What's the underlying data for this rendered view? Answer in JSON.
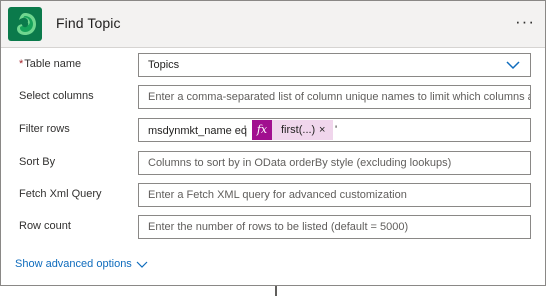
{
  "header": {
    "title": "Find Topic",
    "more_label": "···",
    "logo_icon": "dataverse-logo",
    "accent": "#0b7a4b"
  },
  "fields": {
    "table_name": {
      "required_mark": "*",
      "label": "Table name",
      "value": "Topics"
    },
    "select_columns": {
      "label": "Select columns",
      "placeholder": "Enter a comma-separated list of column unique names to limit which columns are listed"
    },
    "filter_rows": {
      "label": "Filter rows",
      "text_before": "msdynmkt_name eq",
      "quote_open": "'",
      "token_label": "first(...)",
      "token_remove": "×",
      "quote_close": "'",
      "token_color": "#a10f8f"
    },
    "sort_by": {
      "label": "Sort By",
      "placeholder": "Columns to sort by in OData orderBy style (excluding lookups)"
    },
    "fetch_xml": {
      "label": "Fetch Xml Query",
      "placeholder": "Enter a Fetch XML query for advanced customization"
    },
    "row_count": {
      "label": "Row count",
      "placeholder": "Enter the number of rows to be listed (default = 5000)"
    }
  },
  "advanced": {
    "label": "Show advanced options"
  }
}
